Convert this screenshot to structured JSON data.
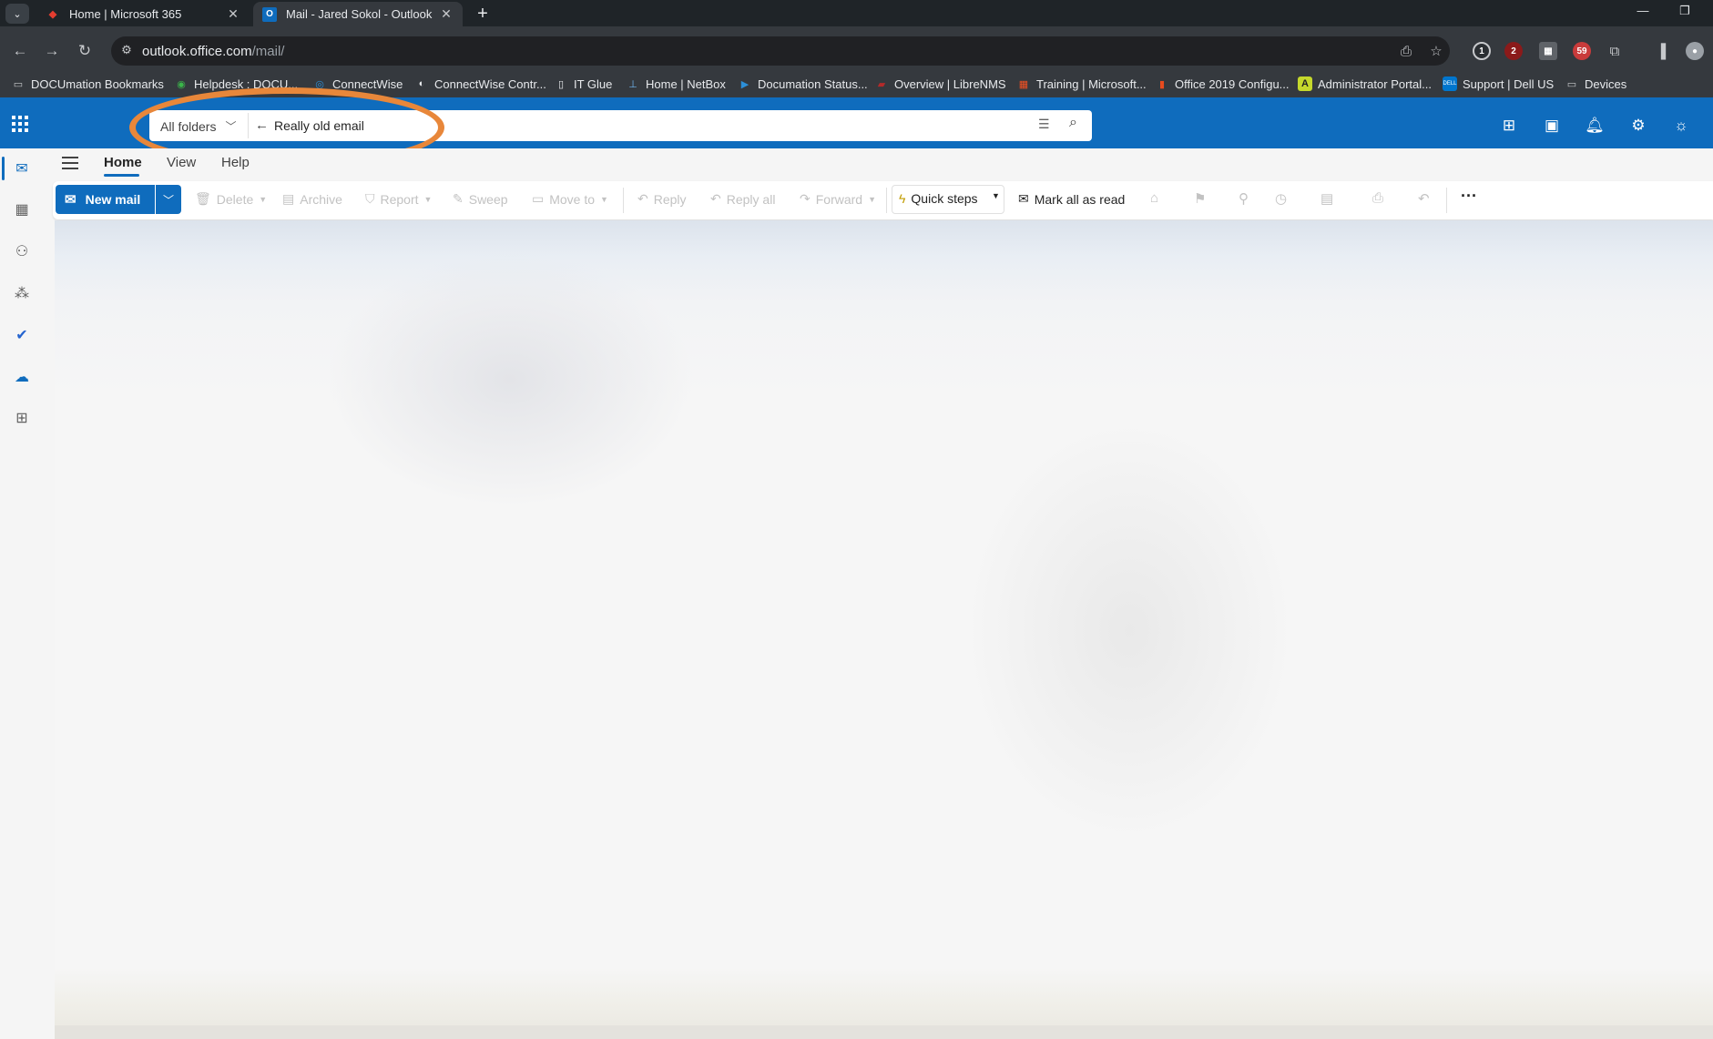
{
  "browser": {
    "tabs": [
      {
        "title": "Home | Microsoft 365",
        "active": false,
        "favicon": "microsoft-365-icon"
      },
      {
        "title": "Mail - Jared Sokol - Outlook",
        "active": true,
        "favicon": "outlook-icon"
      }
    ],
    "url_domain": "outlook.office.com",
    "url_path": "/mail/",
    "bookmarks": [
      "DOCUmation Bookmarks",
      "Helpdesk : DOCU...",
      "ConnectWise",
      "ConnectWise Contr...",
      "IT Glue",
      "Home | NetBox",
      "Documation Status...",
      "Overview | LibreNMS",
      "Training | Microsoft...",
      "Office 2019 Configu...",
      "Administrator Portal...",
      "Support | Dell US",
      "Devices"
    ],
    "extension_badges": {
      "badge_1": "2",
      "badge_2": "59"
    }
  },
  "outlook": {
    "search": {
      "scope": "All folders",
      "query": "Really old email"
    },
    "ribbon_tabs": [
      "Home",
      "View",
      "Help"
    ],
    "commands": {
      "new_mail": "New mail",
      "delete": "Delete",
      "archive": "Archive",
      "report": "Report",
      "sweep": "Sweep",
      "move_to": "Move to",
      "reply": "Reply",
      "reply_all": "Reply all",
      "forward": "Forward",
      "quick_steps": "Quick steps",
      "mark_all_read": "Mark all as read"
    },
    "accent_color": "#0f6cbd",
    "annotation_color": "#e8873a"
  }
}
